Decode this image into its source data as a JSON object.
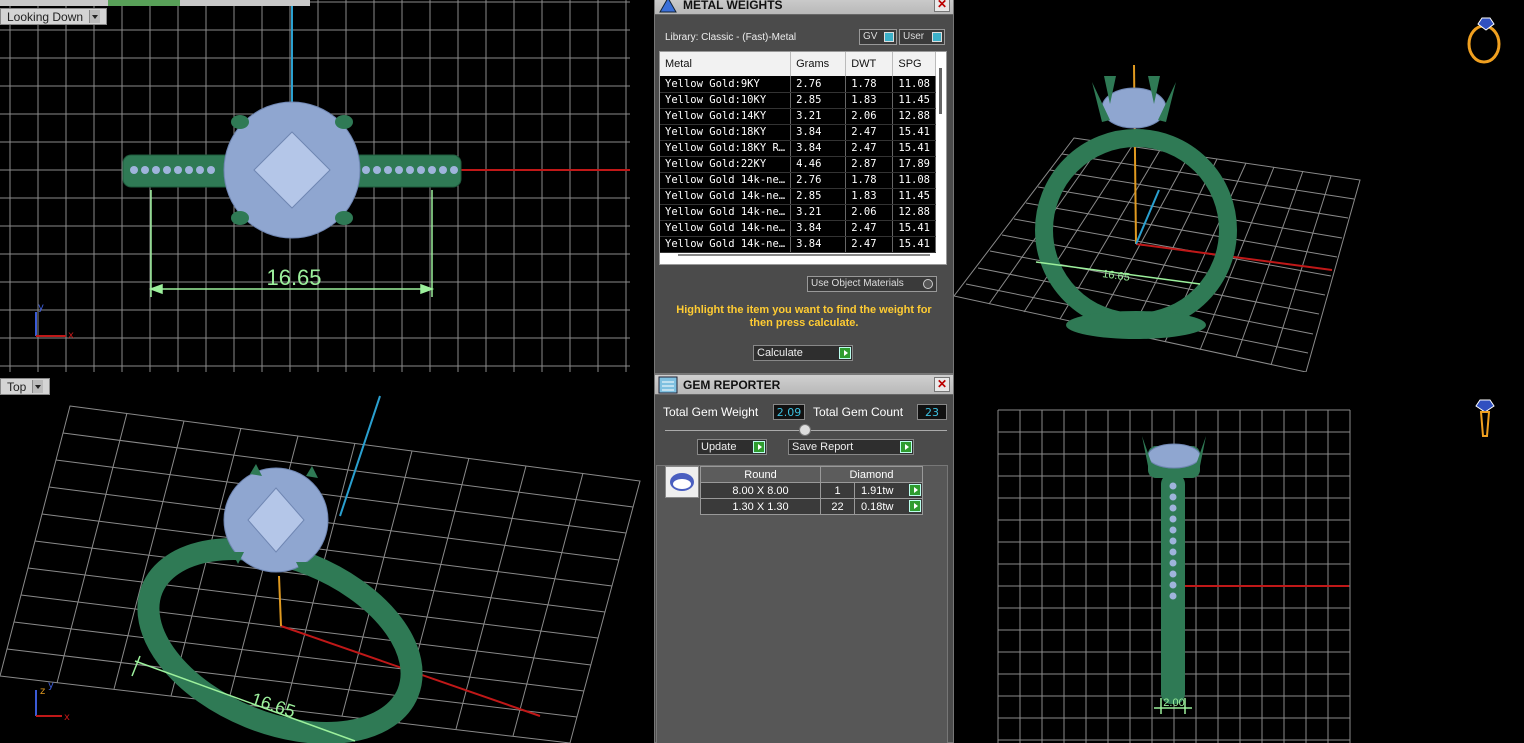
{
  "top_tabs": [
    "",
    "",
    "",
    ""
  ],
  "viewports": {
    "top_left": {
      "label": "Looking Down",
      "dimension": "16.65"
    },
    "bottom_left": {
      "label": "Top",
      "dimension": "16.65"
    },
    "top_right": {
      "dimension": "16.65"
    },
    "bottom_right": {
      "dimension": "2.00"
    }
  },
  "metal_weights": {
    "title": "METAL WEIGHTS",
    "library": "Library: Classic - (Fast)-Metal",
    "toggle_gv": "GV",
    "toggle_user": "User",
    "columns": [
      "Metal",
      "Grams",
      "DWT",
      "SPG"
    ],
    "rows": [
      [
        "Yellow Gold:9KY",
        "2.76",
        "1.78",
        "11.08"
      ],
      [
        "Yellow Gold:10KY",
        "2.85",
        "1.83",
        "11.45"
      ],
      [
        "Yellow Gold:14KY",
        "3.21",
        "2.06",
        "12.88"
      ],
      [
        "Yellow Gold:18KY",
        "3.84",
        "2.47",
        "15.41"
      ],
      [
        "Yellow Gold:18KY R…",
        "3.84",
        "2.47",
        "15.41"
      ],
      [
        "Yellow Gold:22KY",
        "4.46",
        "2.87",
        "17.89"
      ],
      [
        "Yellow Gold 14k-ne…",
        "2.76",
        "1.78",
        "11.08"
      ],
      [
        "Yellow Gold 14k-ne…",
        "2.85",
        "1.83",
        "11.45"
      ],
      [
        "Yellow Gold 14k-ne…",
        "3.21",
        "2.06",
        "12.88"
      ],
      [
        "Yellow Gold 14k-ne…",
        "3.84",
        "2.47",
        "15.41"
      ],
      [
        "Yellow Gold 14k-ne…",
        "3.84",
        "2.47",
        "15.41"
      ]
    ],
    "use_object_materials": "Use Object Materials",
    "instruction": "Highlight the item you want to find the weight for then press calculate.",
    "calculate": "Calculate"
  },
  "gem_reporter": {
    "title": "GEM REPORTER",
    "total_weight_label": "Total Gem Weight",
    "total_weight_value": "2.09",
    "total_count_label": "Total Gem Count",
    "total_count_value": "23",
    "update": "Update",
    "save_report": "Save Report",
    "table_shape": "Round",
    "table_type": "Diamond",
    "rows": [
      {
        "size": "8.00 X 8.00",
        "count": "1",
        "weight": "1.91tw"
      },
      {
        "size": "1.30 X 1.30",
        "count": "22",
        "weight": "0.18tw"
      }
    ]
  },
  "colors": {
    "ring_green": "#2f7a55",
    "gem_blue": "#8fa6d0",
    "dimension_green": "#9cf09c",
    "grid": "#9a9a9a",
    "instruction_yellow": "#ffcc33"
  }
}
